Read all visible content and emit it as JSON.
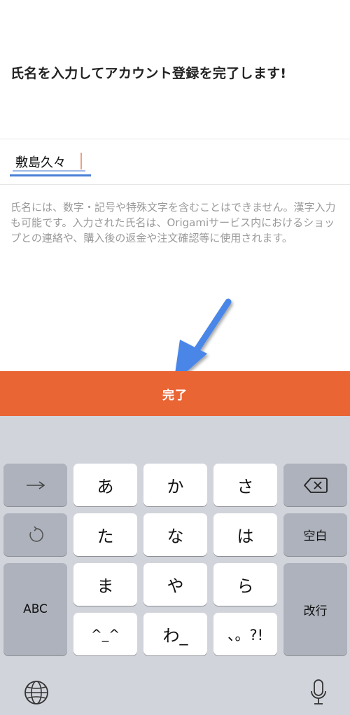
{
  "header": {
    "title": "氏名を入力してアカウント登録を完了します!"
  },
  "name_input": {
    "value": "敷島久々"
  },
  "notice": {
    "text": "氏名には、数字・記号や特殊文字を含むことはできません。漢字入力も可能です。入力された氏名は、Origamiサービス内におけるショップとの連絡や、購入後の返金や注文確認等に使用されます。"
  },
  "done_button": {
    "label": "完了"
  },
  "colors": {
    "accent": "#ea6534",
    "input_underline": "#4a7fd6",
    "annotation_arrow": "#4a86e8"
  },
  "keyboard": {
    "keys": {
      "a": "あ",
      "ka": "か",
      "sa": "さ",
      "ta": "た",
      "na": "な",
      "ha": "は",
      "ma": "ま",
      "ya": "や",
      "ra": "ら",
      "kaomoji": "^_^",
      "wa": "わ_",
      "punct": "、。?!",
      "space": "空白",
      "abc": "ABC",
      "enter": "改行"
    },
    "icons": {
      "next": "arrow-right-icon",
      "undo": "undo-icon",
      "delete": "backspace-icon",
      "globe": "globe-icon",
      "mic": "microphone-icon"
    }
  }
}
